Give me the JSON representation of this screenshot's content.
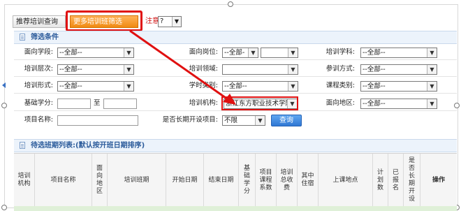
{
  "tabs": {
    "recommend_label": "推荐培训查询",
    "more_label": "更多培训班筛选",
    "note_text": "注意",
    "help_value": "?"
  },
  "filter": {
    "title": "筛选条件",
    "rows": [
      [
        {
          "label": "面向学段:",
          "value": "--全部--"
        },
        {
          "label": "面向岗位:",
          "value": "--全部-",
          "value2": ""
        },
        {
          "label": "培训学科:",
          "value": "--全部--"
        }
      ],
      [
        {
          "label": "培训层次:",
          "value": "--全部--"
        },
        {
          "label": "培训领域:",
          "value": ""
        },
        {
          "label": "参训方式:",
          "value": "--全部--"
        }
      ],
      [
        {
          "label": "培训形式:",
          "value": "--全部--"
        },
        {
          "label": "学时类别:",
          "value": "--全部--"
        },
        {
          "label": "课程类别:",
          "value": "--全部--"
        }
      ]
    ],
    "credit_label": "基础学分:",
    "credit_to": "至",
    "institution_label": "培训机构:",
    "institution_value": "浙江东方职业技术学院",
    "region_label": "面向地区:",
    "region_value": "--全部--",
    "project_label": "项目名称:",
    "longterm_label": "是否长期开设项目:",
    "longterm_value": "不限",
    "query_label": "查询"
  },
  "list": {
    "title": "待选班期列表:(默认按开班日期排序)",
    "columns": [
      "培训机构",
      "项目名称",
      "面向地区",
      "培训班期",
      "开始日期",
      "结束日期",
      "基础学分",
      "项目课程系数",
      "培训总收费",
      "其中住宿",
      "上课地点",
      "计划数",
      "已报名",
      "是否长期开设",
      "操作"
    ]
  },
  "colors": {
    "highlight": "#e01010",
    "accent": "#2f77d4",
    "section_text": "#2a5a9a"
  }
}
